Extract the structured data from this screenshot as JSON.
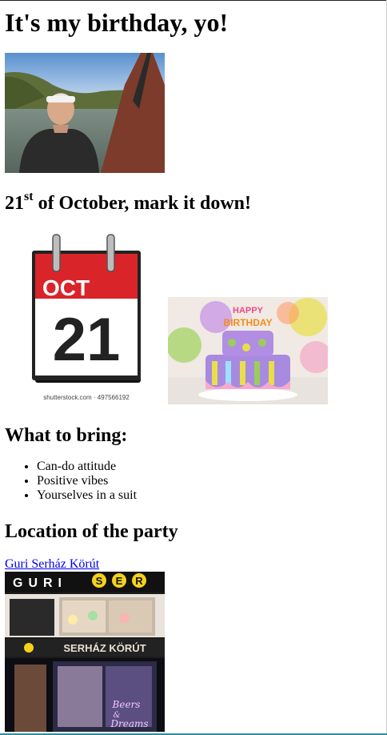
{
  "page": {
    "title": "It's my birthday, yo!",
    "date_heading": {
      "day": "21",
      "suffix": "st",
      "rest": " of October, mark it down!"
    },
    "bring_heading": "What to bring:",
    "bring_items": [
      "Can-do attitude",
      "Positive vibes",
      "Yourselves in a suit"
    ],
    "location_heading": "Location of the party",
    "location_link": "Guri Serház Körút"
  },
  "calendar_image": {
    "month": "OCT",
    "day": "21",
    "credit": "shutterstock.com · 497566192"
  },
  "cake_image": {
    "banner_line1": "HAPPY",
    "banner_line2": "BIRTHDAY"
  },
  "shop_image": {
    "sign_top": "GURI",
    "sign_circles": [
      "S",
      "E",
      "R"
    ],
    "sign_middle": "SERHÁZ KÖRÚT",
    "neon": [
      "Beers",
      "&",
      "Dreams"
    ]
  },
  "colors": {
    "link": "#0000ee",
    "calendar_red": "#d9242a",
    "sign_yellow": "#f4d21c"
  }
}
